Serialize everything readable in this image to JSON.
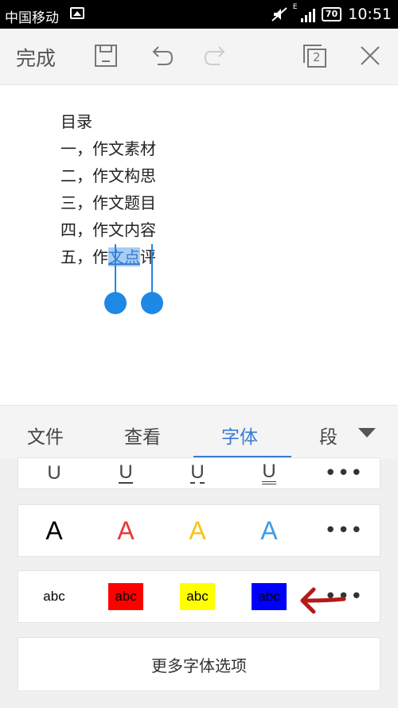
{
  "status": {
    "carrier": "中国移动",
    "signal_label": "E",
    "battery": "70",
    "time": "10:51"
  },
  "toolbar": {
    "done_label": "完成",
    "window_count": "2"
  },
  "document": {
    "lines": [
      "目录",
      "一，作文素材",
      "二，作文构思",
      "三，作文题目",
      "四，作文内容"
    ],
    "last_line": {
      "prefix": "五，作",
      "selected": "文点",
      "suffix": "评"
    }
  },
  "tabs": [
    {
      "label": "文件",
      "active": false
    },
    {
      "label": "查看",
      "active": false
    },
    {
      "label": "字体",
      "active": true
    },
    {
      "label": "段",
      "active": false
    }
  ],
  "font_panel": {
    "underline_row": [
      "U",
      "U",
      "U",
      "U",
      "•••"
    ],
    "color_row": {
      "glyph": "A",
      "colors": [
        "#000000",
        "#e53935",
        "#f5c518",
        "#3d9be9"
      ],
      "more": "•••"
    },
    "highlight_row": {
      "text": "abc",
      "backgrounds": [
        "transparent",
        "#ff0000",
        "#ffff00",
        "#0000ff"
      ],
      "more": "•••"
    },
    "more_options_label": "更多字体选项"
  },
  "accent_color": "#3a7bd5",
  "annotation_arrow_color": "#b21a1a"
}
